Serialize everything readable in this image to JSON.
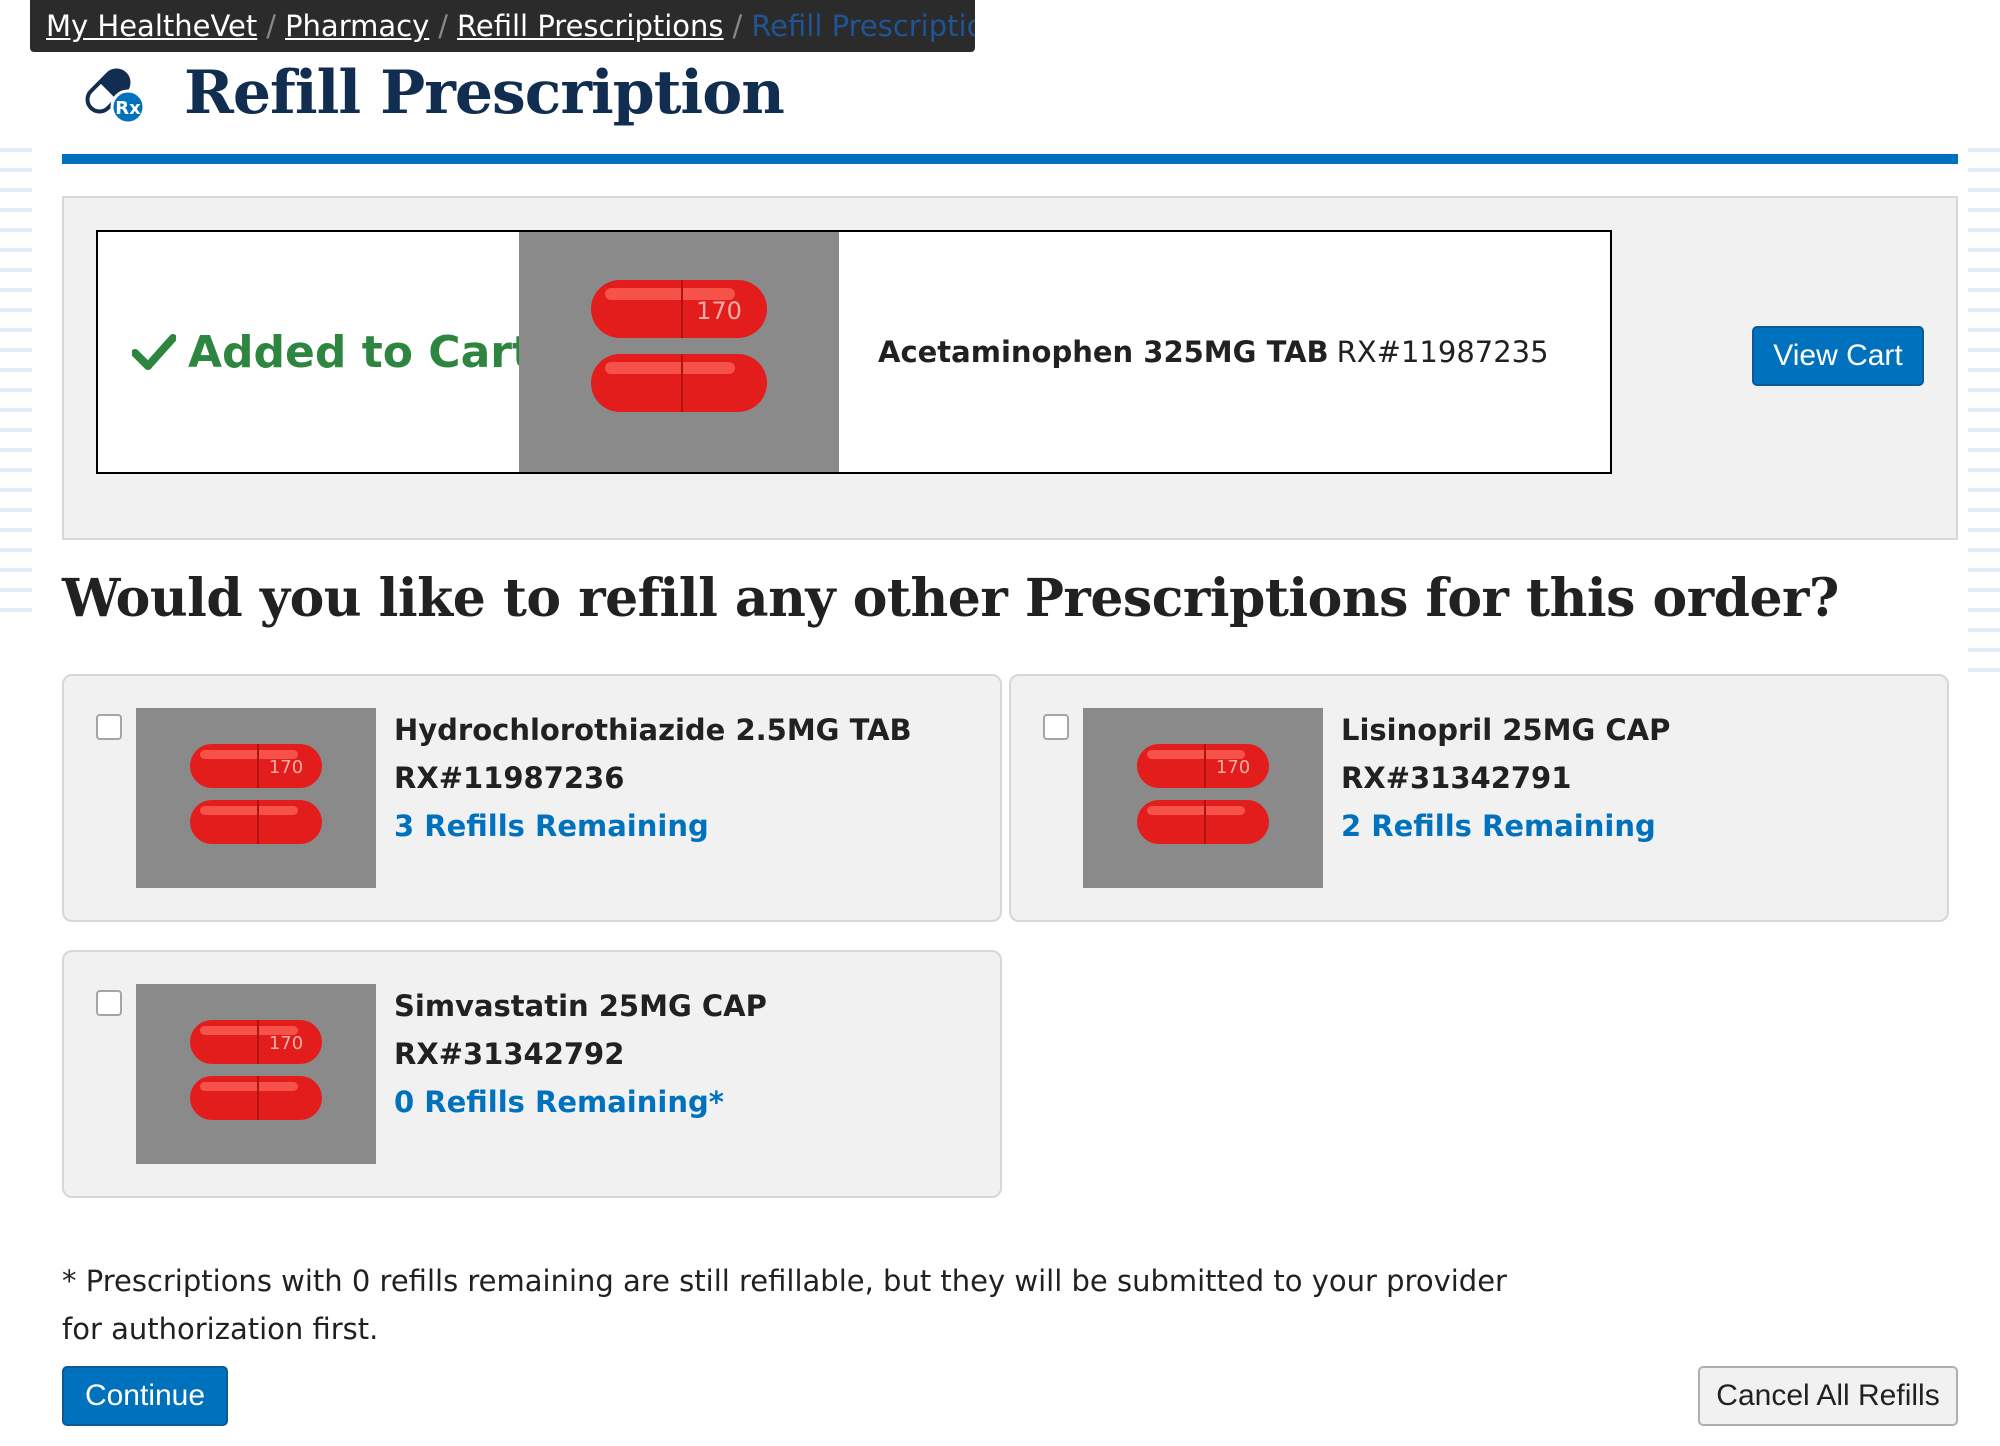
{
  "breadcrumb": {
    "items": [
      "My HealtheVet",
      "Pharmacy",
      "Refill Prescriptions"
    ],
    "current": "Refill Prescription",
    "separator": "/"
  },
  "header": {
    "title": "Refill Prescription",
    "icon": "rx-capsule-icon"
  },
  "added": {
    "status": "Added to Cart",
    "drug": "Acetaminophen 325MG TAB",
    "rx": "RX#11987235",
    "pill_label": "170",
    "view_cart_label": "View Cart"
  },
  "question": "Would you like to refill any other Prescriptions for this order?",
  "prescriptions": [
    {
      "name": "Hydrochlorothiazide 2.5MG TAB",
      "rx": "RX#11987236",
      "refills": "3 Refills Remaining",
      "pill_label": "170",
      "checked": false
    },
    {
      "name": "Lisinopril 25MG CAP",
      "rx": "RX#31342791",
      "refills": "2 Refills Remaining",
      "pill_label": "170",
      "checked": false
    },
    {
      "name": "Simvastatin 25MG CAP",
      "rx": "RX#31342792",
      "refills": "0 Refills Remaining*",
      "pill_label": "170",
      "checked": false
    }
  ],
  "footnote": "* Prescriptions with 0 refills remaining are still refillable, but they will be submitted to your provider for authorization first.",
  "buttons": {
    "continue": "Continue",
    "cancel": "Cancel All Refills"
  },
  "colors": {
    "brand_blue": "#0071bc",
    "dark_blue": "#112e51",
    "success_green": "#2e8540",
    "pill_red": "#e31c1c"
  }
}
